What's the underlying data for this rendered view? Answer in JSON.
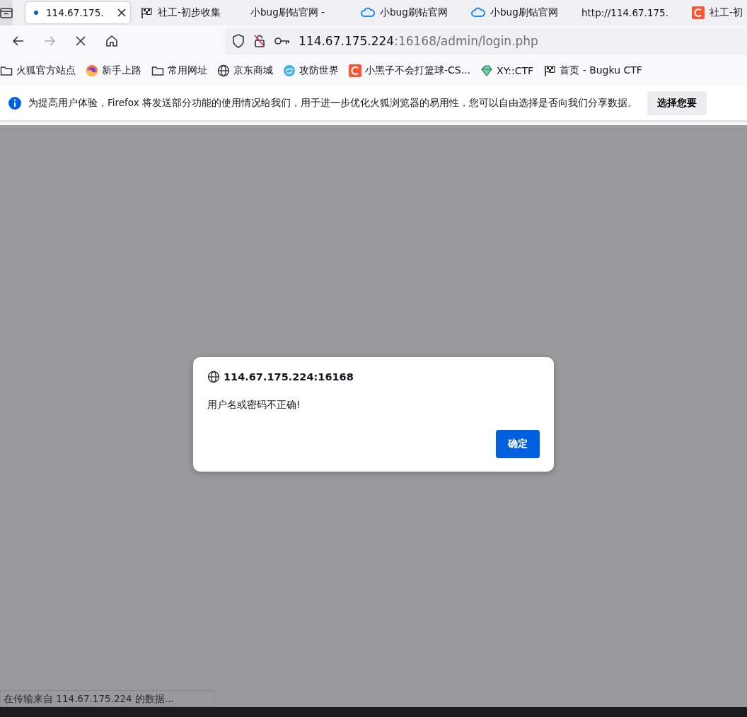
{
  "tab_bar": {
    "tabs": [
      {
        "title": "114.67.175.",
        "kind": "loading",
        "selected": true
      },
      {
        "title": "社工-初步收集",
        "kind": "flag",
        "selected": false
      },
      {
        "title": "小bug刷钻官网 -",
        "kind": "plain",
        "selected": false
      },
      {
        "title": "小bug刷钻官网",
        "kind": "cloud",
        "selected": false
      },
      {
        "title": "小bug刷钻官网",
        "kind": "cloud",
        "selected": false
      },
      {
        "title": "http://114.67.175.",
        "kind": "plain",
        "selected": false
      },
      {
        "title": "社工-初",
        "kind": "csdn",
        "selected": false
      }
    ]
  },
  "nav": {
    "buttons": [
      {
        "kind": "back",
        "disabled": false
      },
      {
        "kind": "forward",
        "disabled": true
      },
      {
        "kind": "stop",
        "disabled": false
      },
      {
        "kind": "home",
        "disabled": false
      }
    ],
    "address": {
      "host": "114.67.175.224",
      "path": ":16168/admin/login.php"
    }
  },
  "bookmarks": [
    {
      "label": "火狐官方站点",
      "kind": "folder"
    },
    {
      "label": "新手上路",
      "kind": "firefox"
    },
    {
      "label": "常用网址",
      "kind": "folder"
    },
    {
      "label": "京东商城",
      "kind": "globe"
    },
    {
      "label": "攻防世界",
      "kind": "swirl"
    },
    {
      "label": "小黑子不会打篮球-CS...",
      "kind": "csdn"
    },
    {
      "label": "XY::CTF",
      "kind": "gem"
    },
    {
      "label": "首页 - Bugku CTF",
      "kind": "flag"
    }
  ],
  "notification": {
    "message": "为提高用户体验，Firefox 将发送部分功能的使用情况给我们，用于进一步优化火狐浏览器的易用性，您可以自由选择是否向我们分享数据。",
    "button": "选择您要"
  },
  "dialog": {
    "origin": "114.67.175.224:16168",
    "message": "用户名或密码不正确!",
    "button": "确定"
  },
  "status": "在传输来自 114.67.175.224 的数据..."
}
